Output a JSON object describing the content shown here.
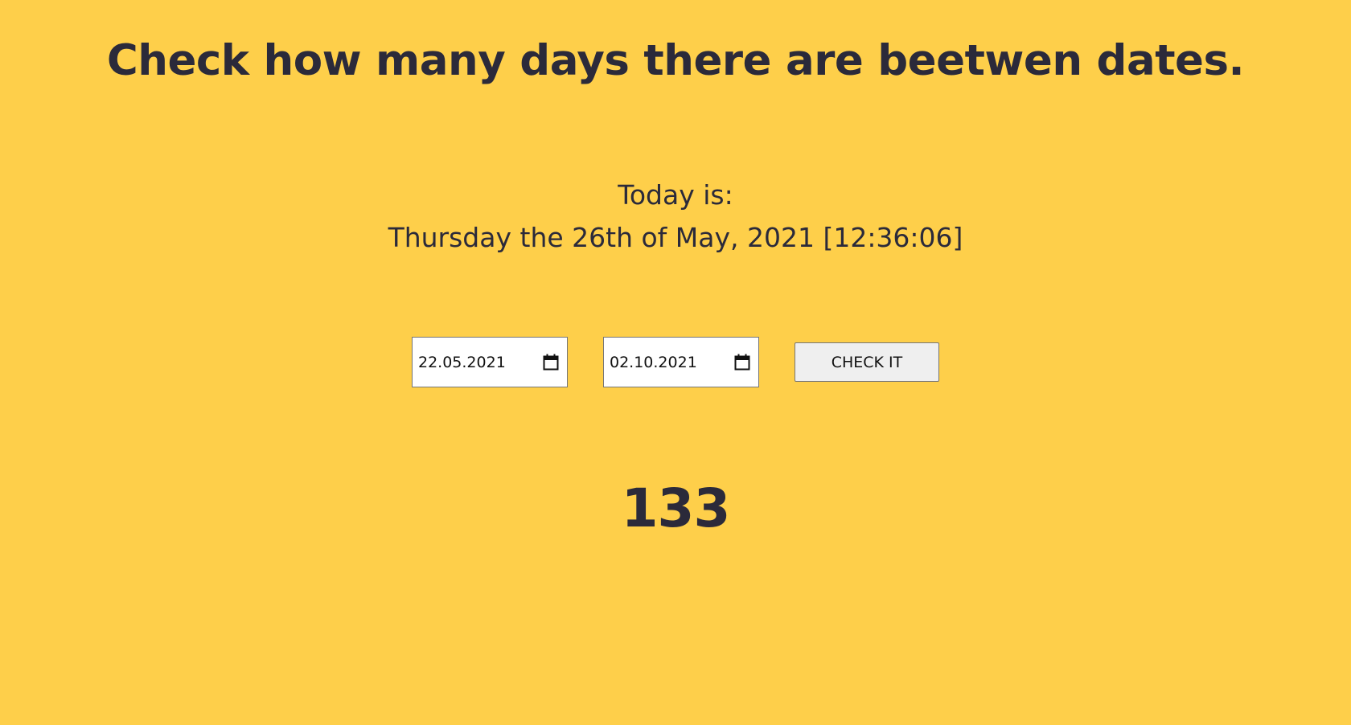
{
  "page": {
    "title": "Check how many days there are beetwen dates.",
    "today_label": "Today is:",
    "today_value": "Thursday the 26th of May, 2021 [12:36:06]"
  },
  "controls": {
    "start_date": "22.05.2021",
    "end_date": "02.10.2021",
    "calendar_icon": "calendar-icon",
    "check_label": "CHECK IT"
  },
  "result": {
    "days": "133"
  },
  "colors": {
    "background": "#fecf4a",
    "text": "#2b2a3a",
    "input_background": "#ffffff",
    "button_background": "#efefef"
  }
}
